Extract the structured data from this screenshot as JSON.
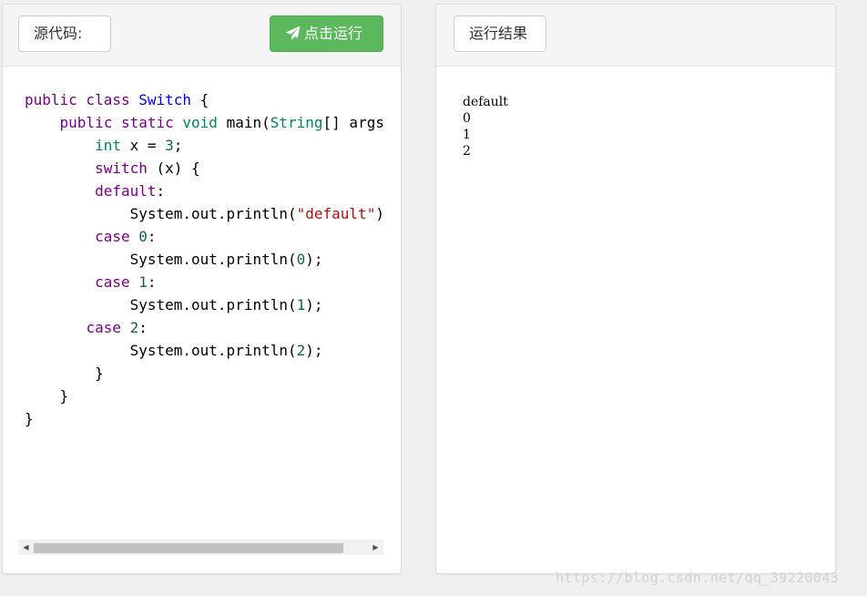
{
  "source_panel": {
    "source_label": "源代码:",
    "run_button_label": "点击运行",
    "run_icon": "paper-plane-icon",
    "code_lines": [
      [
        {
          "t": "public class",
          "c": "kw"
        },
        {
          "t": " "
        },
        {
          "t": "Switch",
          "c": "def"
        },
        {
          "t": " {"
        }
      ],
      [
        {
          "t": "    "
        },
        {
          "t": "public static",
          "c": "kw"
        },
        {
          "t": " "
        },
        {
          "t": "void",
          "c": "typ"
        },
        {
          "t": " main("
        },
        {
          "t": "String",
          "c": "typ"
        },
        {
          "t": "[] args"
        }
      ],
      [
        {
          "t": "        "
        },
        {
          "t": "int",
          "c": "typ"
        },
        {
          "t": " x = "
        },
        {
          "t": "3",
          "c": "num"
        },
        {
          "t": ";"
        }
      ],
      [
        {
          "t": "        "
        },
        {
          "t": "switch",
          "c": "kw"
        },
        {
          "t": " (x) {"
        }
      ],
      [
        {
          "t": "        "
        },
        {
          "t": "default",
          "c": "kw"
        },
        {
          "t": ":"
        }
      ],
      [
        {
          "t": "            System.out.println("
        },
        {
          "t": "\"default\"",
          "c": "str"
        },
        {
          "t": ")"
        }
      ],
      [
        {
          "t": "        "
        },
        {
          "t": "case",
          "c": "kw"
        },
        {
          "t": " "
        },
        {
          "t": "0",
          "c": "num"
        },
        {
          "t": ":"
        }
      ],
      [
        {
          "t": "            System.out.println("
        },
        {
          "t": "0",
          "c": "num"
        },
        {
          "t": ");"
        }
      ],
      [
        {
          "t": "        "
        },
        {
          "t": "case",
          "c": "kw"
        },
        {
          "t": " "
        },
        {
          "t": "1",
          "c": "num"
        },
        {
          "t": ":"
        }
      ],
      [
        {
          "t": "            System.out.println("
        },
        {
          "t": "1",
          "c": "num"
        },
        {
          "t": ");"
        }
      ],
      [
        {
          "t": "       "
        },
        {
          "t": "case",
          "c": "kw"
        },
        {
          "t": " "
        },
        {
          "t": "2",
          "c": "num"
        },
        {
          "t": ":"
        }
      ],
      [
        {
          "t": "            System.out.println("
        },
        {
          "t": "2",
          "c": "num"
        },
        {
          "t": ");"
        }
      ],
      [
        {
          "t": "        }"
        }
      ],
      [
        {
          "t": "    }"
        }
      ],
      [
        {
          "t": "}"
        }
      ]
    ]
  },
  "result_panel": {
    "result_label": "运行结果",
    "output_lines": [
      "default",
      "0",
      "1",
      "2"
    ]
  },
  "watermark": "https://blog.csdn.net/qq_39220043",
  "colors": {
    "run_button": "#5cb85c",
    "keyword": "#770088",
    "class_name": "#0000ff",
    "type": "#008855",
    "number": "#116644",
    "string": "#aa1111"
  }
}
